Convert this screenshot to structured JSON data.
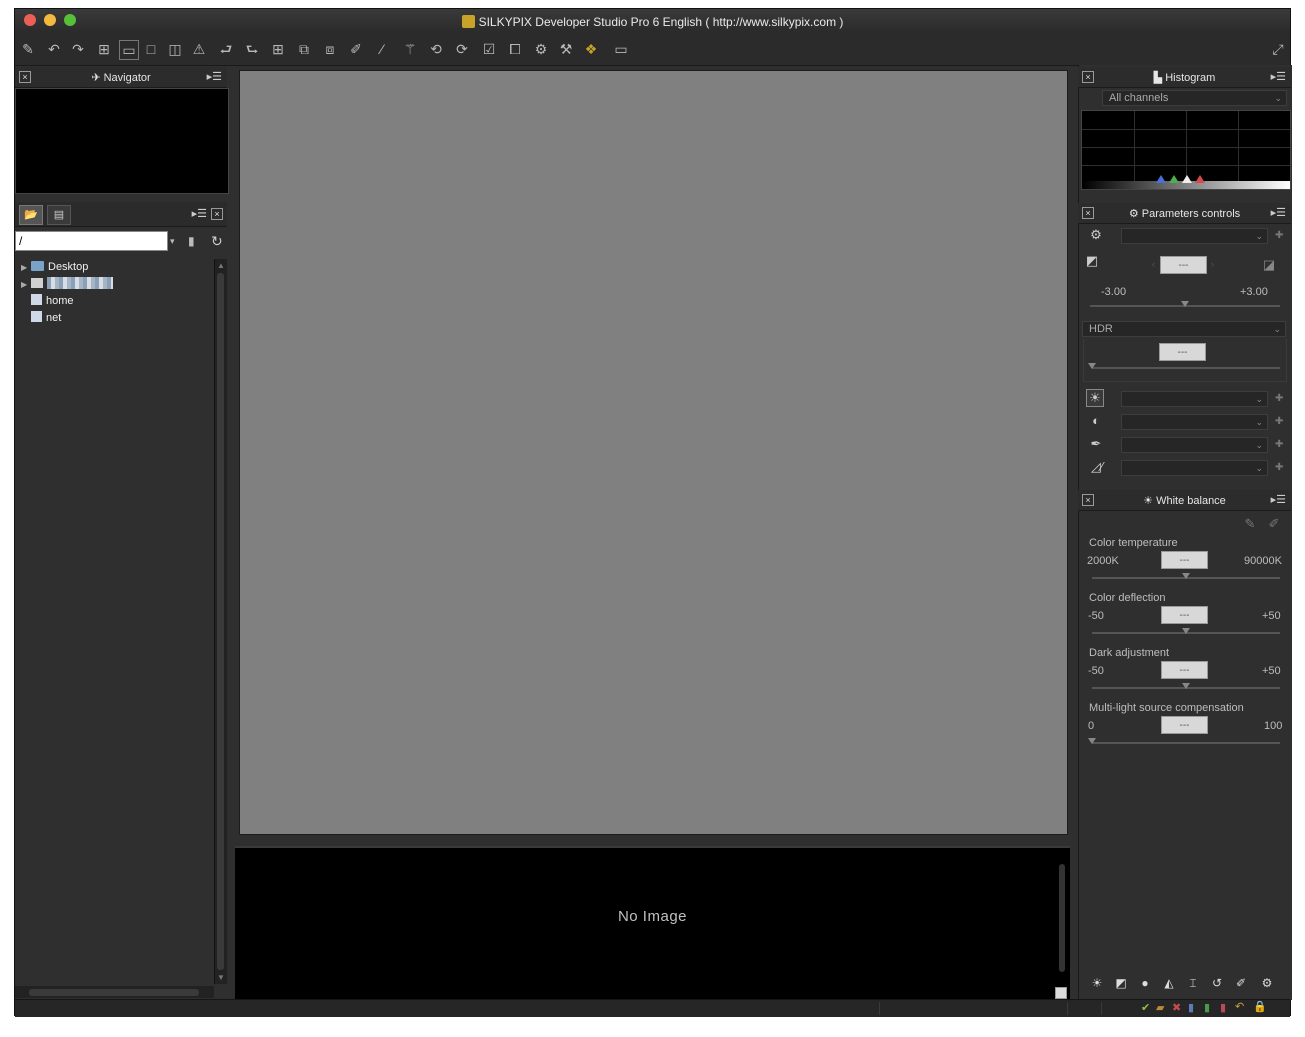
{
  "window": {
    "title": "SILKYPIX Developer Studio Pro 6 English ( http://www.silkypix.com )",
    "traffic_lights": [
      "#ec5f56",
      "#f3b93e",
      "#57c038"
    ]
  },
  "navigator": {
    "title": "Navigator"
  },
  "folder_panel": {
    "path_value": "/",
    "tree": [
      {
        "label": "Desktop",
        "icon": "folder-icon",
        "expandable": true
      },
      {
        "label": "",
        "icon": "disk-icon",
        "expandable": true
      },
      {
        "label": "home",
        "icon": "network-icon",
        "expandable": false
      },
      {
        "label": "net",
        "icon": "network-icon",
        "expandable": false
      }
    ]
  },
  "preview": {
    "no_image": "No Image"
  },
  "histogram": {
    "title": "Histogram",
    "channel": "All channels"
  },
  "parameters": {
    "title": "Parameters controls",
    "exposure_value": "---",
    "exposure_min": "-3.00",
    "exposure_max": "+3.00",
    "exposure_level": 0.5,
    "hdr_label": "HDR",
    "hdr_value": "---",
    "hdr_level": 0.0
  },
  "white_balance": {
    "title": "White balance",
    "rows": [
      {
        "label": "Color temperature",
        "min": "2000K",
        "max": "90000K",
        "value": "---",
        "level": 0.5
      },
      {
        "label": "Color deflection",
        "min": "-50",
        "max": "+50",
        "value": "---",
        "level": 0.5
      },
      {
        "label": "Dark adjustment",
        "min": "-50",
        "max": "+50",
        "value": "---",
        "level": 0.5
      },
      {
        "label": "Multi-light source compensation",
        "min": "0",
        "max": "100",
        "value": "---",
        "level": 0.0
      }
    ]
  }
}
